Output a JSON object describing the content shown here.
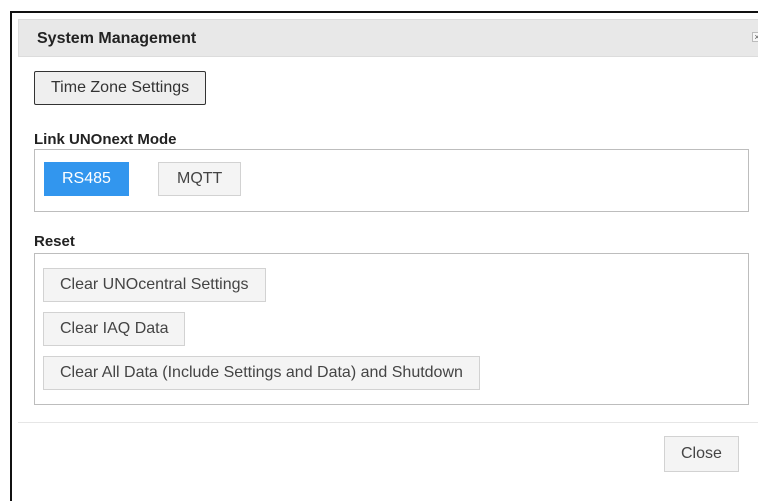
{
  "dialog": {
    "title": "System Management",
    "close_icon_glyph": "×",
    "close_icon": "close-icon"
  },
  "time_zone": {
    "button_label": "Time Zone Settings"
  },
  "link_mode": {
    "label": "Link UNOnext Mode",
    "options": [
      {
        "label": "RS485",
        "active": true
      },
      {
        "label": "MQTT",
        "active": false
      }
    ],
    "active_color": "#3296ee"
  },
  "reset": {
    "label": "Reset",
    "buttons": [
      {
        "label": "Clear UNOcentral Settings"
      },
      {
        "label": "Clear IAQ Data"
      },
      {
        "label": "Clear All Data (Include Settings and Data) and Shutdown"
      }
    ]
  },
  "footer": {
    "close_label": "Close"
  }
}
